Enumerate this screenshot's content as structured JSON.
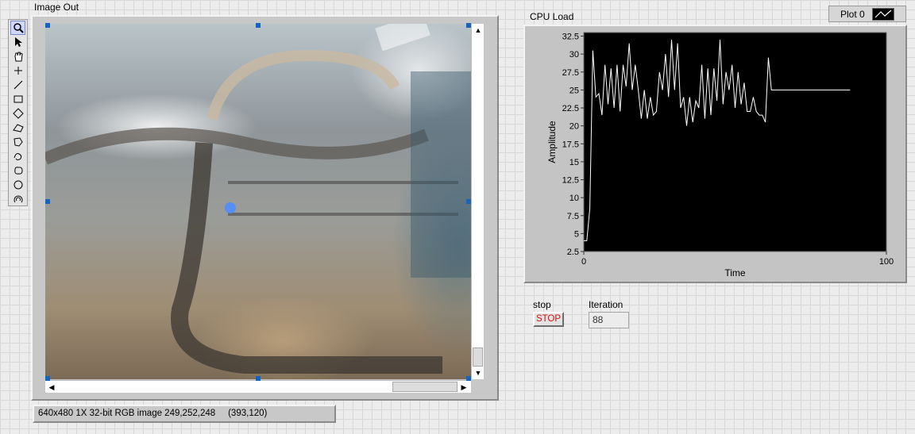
{
  "image_display": {
    "label": "Image Out",
    "status": "640x480 1X 32-bit RGB image 249,252,248     (393,120)"
  },
  "tools": [
    {
      "icon": "zoom-icon"
    },
    {
      "icon": "pointer-icon"
    },
    {
      "icon": "pan-hand-icon"
    },
    {
      "icon": "point-icon"
    },
    {
      "icon": "line-icon"
    },
    {
      "icon": "rectangle-icon"
    },
    {
      "icon": "rotated-rectangle-icon"
    },
    {
      "icon": "annulus-icon"
    },
    {
      "icon": "polygon-icon"
    },
    {
      "icon": "freehand-icon"
    },
    {
      "icon": "freehand-region-icon"
    },
    {
      "icon": "oval-icon"
    },
    {
      "icon": "annulus-arc-icon"
    }
  ],
  "chart": {
    "label": "CPU Load",
    "legend_label": "Plot 0",
    "xlabel": "Time",
    "ylabel": "Amplitude",
    "xticks": [
      "0",
      "100"
    ],
    "yticks": [
      "32.5",
      "30",
      "27.5",
      "25",
      "22.5",
      "20",
      "17.5",
      "15",
      "12.5",
      "10",
      "7.5",
      "5",
      "2.5"
    ],
    "background": "#000000",
    "line_color": "#ffffff"
  },
  "chart_data": {
    "type": "line",
    "title": "CPU Load",
    "xlabel": "Time",
    "ylabel": "Amplitude",
    "xlim": [
      0,
      100
    ],
    "ylim": [
      2.5,
      33
    ],
    "series": [
      {
        "name": "Plot 0",
        "x": [
          0,
          1,
          2,
          3,
          4,
          5,
          6,
          7,
          8,
          9,
          10,
          11,
          12,
          13,
          14,
          15,
          16,
          17,
          18,
          19,
          20,
          21,
          22,
          23,
          24,
          25,
          26,
          27,
          28,
          29,
          30,
          31,
          32,
          33,
          34,
          35,
          36,
          37,
          38,
          39,
          40,
          41,
          42,
          43,
          44,
          45,
          46,
          47,
          48,
          49,
          50,
          51,
          52,
          53,
          54,
          55,
          56,
          57,
          58,
          59,
          60,
          61,
          62,
          63,
          64,
          65,
          66,
          67,
          68,
          69,
          70,
          71,
          72,
          73,
          74,
          75,
          76,
          77,
          78,
          79,
          80,
          81,
          82,
          83,
          84,
          85,
          86,
          87,
          88
        ],
        "y": [
          4,
          4,
          8.5,
          30.5,
          24,
          24.5,
          21.5,
          28.5,
          23,
          28,
          22.5,
          28.5,
          22,
          28.5,
          25.5,
          31.5,
          25,
          28.5,
          25,
          21,
          25,
          21,
          24,
          21.5,
          22,
          27.5,
          25,
          30,
          24,
          32,
          25,
          31.5,
          22.5,
          24,
          20,
          24,
          20.5,
          23.5,
          22.5,
          28.5,
          21,
          28,
          21.5,
          28,
          23.5,
          32,
          23,
          27.5,
          25,
          28.5,
          22.5,
          27.5,
          23,
          26,
          22,
          22,
          24,
          22,
          21.5,
          21.5,
          20.5,
          29.5,
          25,
          25,
          25,
          25,
          25,
          25,
          25,
          25,
          25,
          25,
          25,
          25,
          25,
          25,
          25,
          25,
          25,
          25,
          25,
          25,
          25,
          25,
          25,
          25,
          25,
          25,
          25
        ],
        "points_shown": 91
      }
    ]
  },
  "stop_control": {
    "label": "stop",
    "button_text": "STOP"
  },
  "iteration": {
    "label": "Iteration",
    "value": "88"
  }
}
